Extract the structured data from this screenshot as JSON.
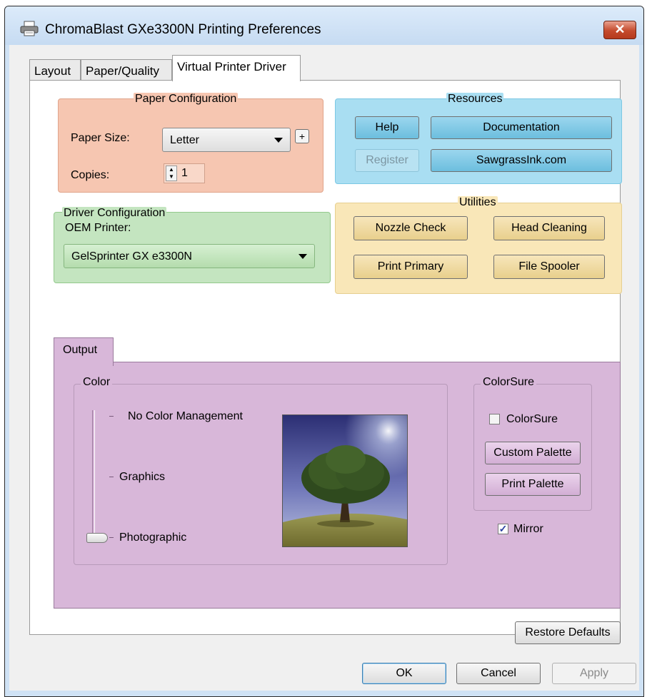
{
  "window": {
    "title": "ChromaBlast GXe3300N Printing Preferences",
    "close_label": "✕"
  },
  "tabs": [
    {
      "label": "Layout"
    },
    {
      "label": "Paper/Quality"
    },
    {
      "label": "Virtual Printer Driver"
    }
  ],
  "paper_config": {
    "title": "Paper Configuration",
    "paper_size_label": "Paper Size:",
    "paper_size_value": "Letter",
    "add_button": "+",
    "copies_label": "Copies:",
    "copies_value": "1",
    "color": "#f6c6b1"
  },
  "resources": {
    "title": "Resources",
    "help": "Help",
    "documentation": "Documentation",
    "register": "Register",
    "website": "SawgrassInk.com",
    "color": "#a9def2"
  },
  "driver_config": {
    "title": "Driver Configuration",
    "oem_label": "OEM Printer:",
    "oem_value": "GelSprinter GX e3300N",
    "color": "#c4e5c0"
  },
  "utilities": {
    "title": "Utilities",
    "nozzle_check": "Nozzle Check",
    "head_cleaning": "Head Cleaning",
    "print_primary": "Print Primary",
    "file_spooler": "File Spooler",
    "color": "#f9e7b8"
  },
  "output": {
    "tab_label": "Output",
    "color_group": "Color",
    "options": [
      "No Color Management",
      "Graphics",
      "Photographic"
    ],
    "selected": "Photographic",
    "colorsure_group": "ColorSure",
    "colorsure_checkbox": "ColorSure",
    "colorsure_checked": false,
    "custom_palette": "Custom Palette",
    "print_palette": "Print Palette",
    "mirror_label": "Mirror",
    "mirror_checked": true,
    "color": "#d8b7d9"
  },
  "restore_defaults": "Restore Defaults",
  "footer": {
    "ok": "OK",
    "cancel": "Cancel",
    "apply": "Apply"
  }
}
